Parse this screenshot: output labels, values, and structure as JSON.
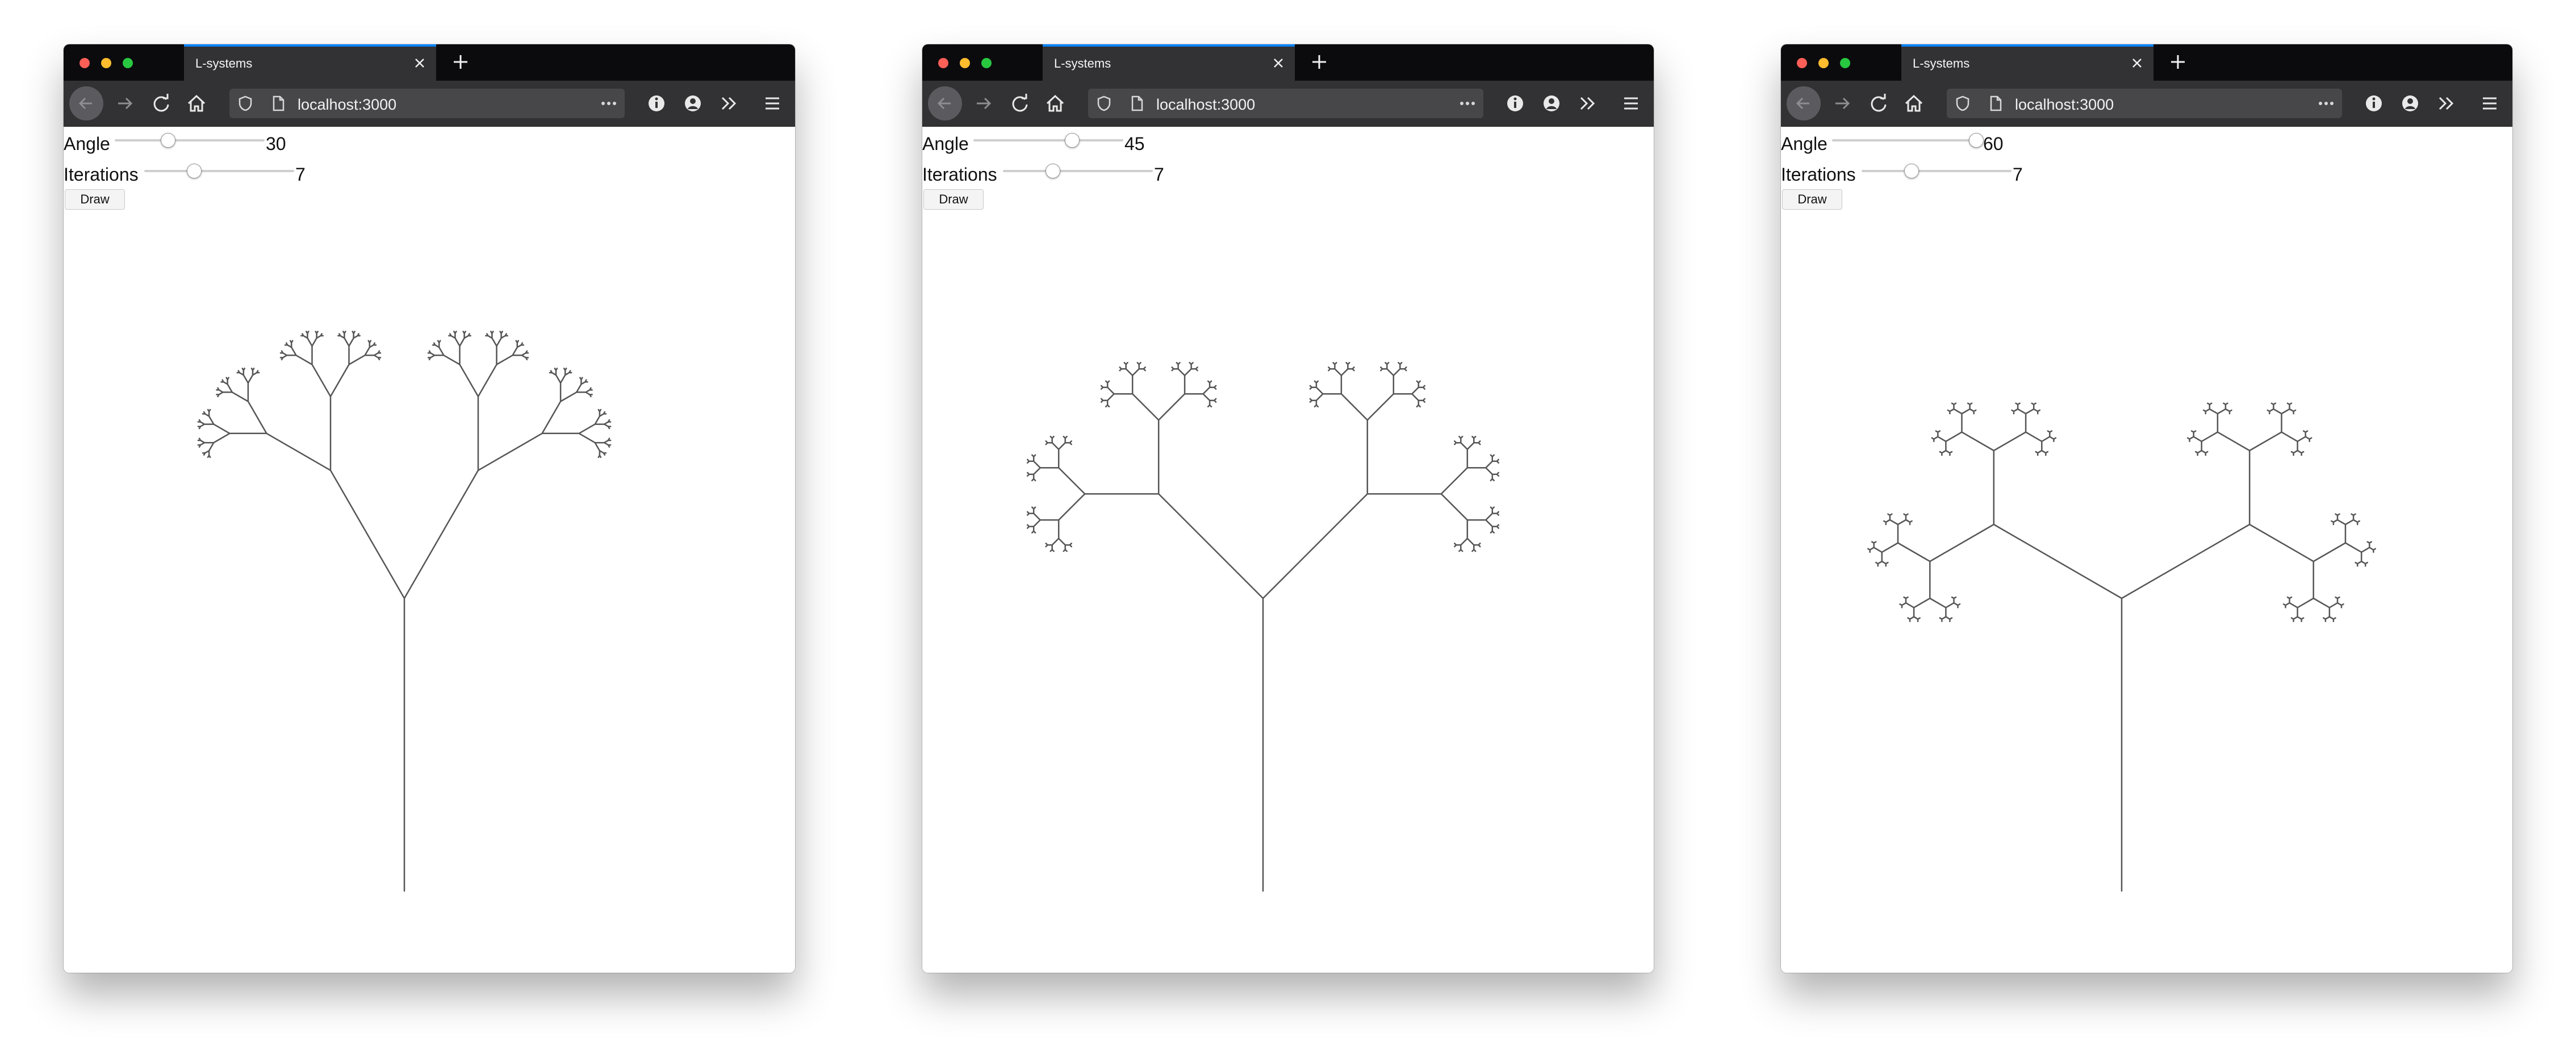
{
  "windows": [
    {
      "tab_title": "L-systems",
      "url": "localhost:3000",
      "angle": {
        "label": "Angle",
        "value": 30,
        "min": 0,
        "max": 90
      },
      "iterations": {
        "label": "Iterations",
        "value": 7,
        "min": 1,
        "max": 12
      },
      "draw_label": "Draw"
    },
    {
      "tab_title": "L-systems",
      "url": "localhost:3000",
      "angle": {
        "label": "Angle",
        "value": 45,
        "min": 0,
        "max": 90
      },
      "iterations": {
        "label": "Iterations",
        "value": 7,
        "min": 1,
        "max": 12
      },
      "draw_label": "Draw"
    },
    {
      "tab_title": "L-systems",
      "url": "localhost:3000",
      "angle": {
        "label": "Angle",
        "value": 60,
        "min": 0,
        "max": 90
      },
      "iterations": {
        "label": "Iterations",
        "value": 7,
        "min": 1,
        "max": 12
      },
      "draw_label": "Draw"
    }
  ],
  "icons": {
    "traffic_lights": [
      "close-dot-icon",
      "minimize-dot-icon",
      "zoom-dot-icon"
    ],
    "toolbar": [
      "back-arrow-icon",
      "forward-arrow-icon",
      "reload-icon",
      "home-icon",
      "shield-icon",
      "page-icon",
      "more-dots-icon",
      "info-icon",
      "account-icon",
      "overflow-chevrons-icon",
      "hamburger-menu-icon"
    ]
  },
  "colors": {
    "tab_accent": "#0a84ff",
    "titlebar": "#0b0b0d",
    "toolbar": "#323234",
    "urlbar": "#474749",
    "tree_stroke": "#555555"
  }
}
